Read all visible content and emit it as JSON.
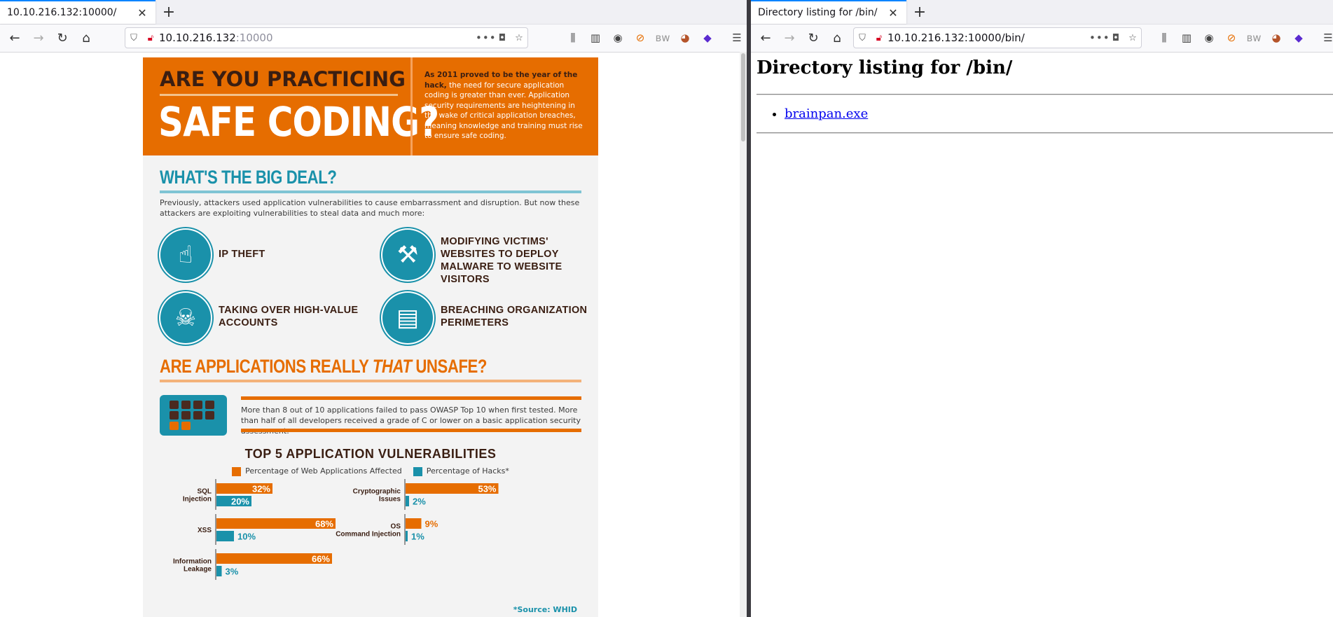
{
  "left": {
    "tab_title": "10.10.216.132:10000/",
    "url_host": "10.10.216.132",
    "url_port": ":10000",
    "page": {
      "hero_small": "ARE YOU PRACTICING",
      "hero_big": "SAFE CODING?",
      "hero_bold": "As 2011 proved to be the year of the hack,",
      "hero_text": "the need for secure application coding is greater than ever. Application security requirements are heightening in the wake of critical application breaches, meaning knowledge and training must rise to ensure safe coding.",
      "section1_title": "WHAT'S THE BIG DEAL?",
      "section1_para": "Previously, attackers used application vulnerabilities to cause embarrassment and disruption. But now these attackers are exploiting vulnerabilities to steal data and much more:",
      "threats": [
        {
          "label": "IP THEFT",
          "icon": "head-hand-icon"
        },
        {
          "label": "MODIFYING VICTIMS' WEBSITES TO DEPLOY MALWARE TO WEBSITE VISITORS",
          "icon": "hammer-icon"
        },
        {
          "label": "TAKING OVER HIGH-VALUE ACCOUNTS",
          "icon": "skull-crossbones-icon"
        },
        {
          "label": "BREACHING ORGANIZATION PERIMETERS",
          "icon": "wallet-cards-icon"
        }
      ],
      "section2_title_a": "ARE APPLICATIONS REALLY ",
      "section2_title_b": "THAT",
      "section2_title_c": " UNSAFE?",
      "section2_para": "More than 8 out of 10 applications failed to pass OWASP Top 10 when first tested. More than half of all developers received a grade of C or lower on a basic application security assessment.",
      "source": "*Source: WHID"
    },
    "colors": {
      "orange": "#e66d00",
      "teal": "#1a91aa",
      "brown": "#3a1e12"
    }
  },
  "chart_data": {
    "type": "bar",
    "title": "TOP 5 APPLICATION VULNERABILITIES",
    "categories": [
      "SQL Injection",
      "XSS",
      "Information Leakage",
      "Cryptographic Issues",
      "OS Command Injection"
    ],
    "series": [
      {
        "name": "Percentage of Web Applications Affected",
        "color": "#e66d00",
        "values": [
          32,
          68,
          66,
          53,
          9
        ]
      },
      {
        "name": "Percentage of Hacks*",
        "color": "#1a91aa",
        "values": [
          20,
          10,
          3,
          2,
          1
        ]
      }
    ],
    "value_suffix": "%",
    "orientation": "horizontal"
  },
  "right": {
    "tab_title": "Directory listing for /bin/",
    "url": "10.10.216.132:10000/bin/",
    "heading": "Directory listing for /bin/",
    "files": [
      "brainpan.exe"
    ]
  },
  "icons": {
    "back": "back-arrow-icon",
    "forward": "forward-arrow-icon",
    "reload": "reload-icon",
    "home": "home-icon",
    "shield": "tracking-shield-icon",
    "insecure": "insecure-connection-icon",
    "more": "page-actions-icon",
    "pocket": "pocket-icon",
    "bookmark": "bookmark-star-icon",
    "library": "library-icon",
    "sidebar": "sidebar-icon",
    "account": "account-icon",
    "menu": "hamburger-menu-icon"
  }
}
